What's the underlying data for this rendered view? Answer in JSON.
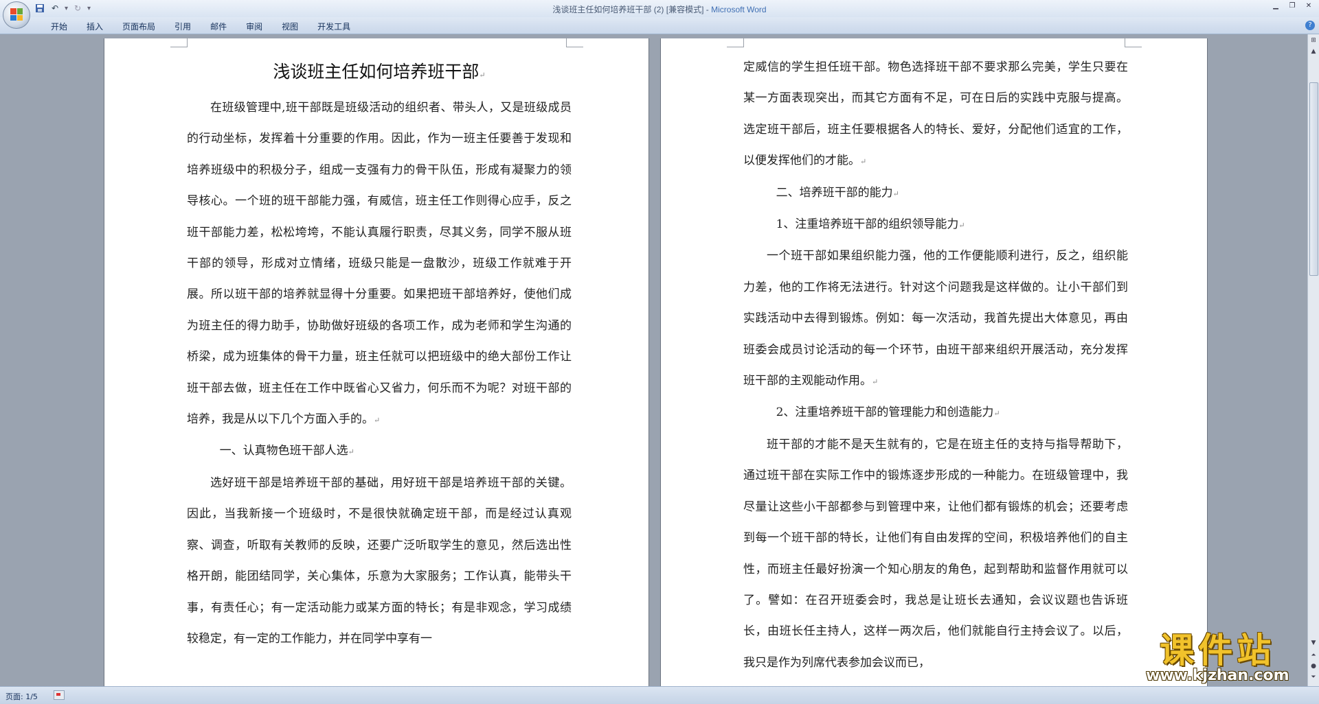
{
  "window": {
    "title": "浅谈班主任如何培养班干部 (2) [兼容模式]",
    "separator": " - ",
    "app_name": "Microsoft Word"
  },
  "ribbon": {
    "tabs": [
      "开始",
      "插入",
      "页面布局",
      "引用",
      "邮件",
      "审阅",
      "视图",
      "开发工具"
    ]
  },
  "status": {
    "page": "页面: 1/5"
  },
  "document": {
    "title": "浅谈班主任如何培养班干部",
    "left_paragraphs": [
      "在班级管理中,班干部既是班级活动的组织者、带头人，又是班级成员的行动坐标，发挥着十分重要的作用。因此，作为一班主任要善于发现和培养班级中的积极分子，组成一支强有力的骨干队伍，形成有凝聚力的领导核心。一个班的班干部能力强，有威信，班主任工作则得心应手，反之班干部能力差，松松垮垮，不能认真履行职责，尽其义务，同学不服从班干部的领导，形成对立情绪，班级只能是一盘散沙，班级工作就难于开展。所以班干部的培养就显得十分重要。如果把班干部培养好，使他们成为班主任的得力助手，协助做好班级的各项工作，成为老师和学生沟通的桥梁，成为班集体的骨干力量，班主任就可以把班级中的绝大部份工作让班干部去做，班主任在工作中既省心又省力，何乐而不为呢？对班干部的培养，我是从以下几个方面入手的。"
    ],
    "left_heading_1": "一、认真物色班干部人选",
    "left_paragraph_2": "选好班干部是培养班干部的基础，用好班干部是培养班干部的关键。因此，当我新接一个班级时，不是很快就确定班干部，而是经过认真观察、调查，听取有关教师的反映，还要广泛听取学生的意见，然后选出性格开朗，能团结同学，关心集体，乐意为大家服务；工作认真，能带头干事，有责任心；有一定活动能力或某方面的特长；有是非观念，学习成绩较稳定，有一定的工作能力，并在同学中享有一",
    "right_paragraph_1": "定威信的学生担任班干部。物色选择班干部不要求那么完美，学生只要在某一方面表现突出，而其它方面有不足，可在日后的实践中克服与提高。选定班干部后，班主任要根据各人的特长、爱好，分配他们适宜的工作，以便发挥他们的才能。",
    "right_heading_2": "二、培养班干部的能力",
    "right_subheading_1": "1、注重培养班干部的组织领导能力",
    "right_paragraph_2": "一个班干部如果组织能力强，他的工作便能顺利进行，反之，组织能力差，他的工作将无法进行。针对这个问题我是这样做的。让小干部们到实践活动中去得到锻炼。例如：每一次活动，我首先提出大体意见，再由班委会成员讨论活动的每一个环节，由班干部来组织开展活动，充分发挥班干部的主观能动作用。",
    "right_subheading_2": "2、注重培养班干部的管理能力和创造能力",
    "right_paragraph_3": "班干部的才能不是天生就有的，它是在班主任的支持与指导帮助下，通过班干部在实际工作中的锻炼逐步形成的一种能力。在班级管理中，我尽量让这些小干部都参与到管理中来，让他们都有锻炼的机会；还要考虑到每一个班干部的特长，让他们有自由发挥的空间，积极培养他们的自主性，而班主任最好扮演一个知心朋友的角色，起到帮助和监督作用就可以了。譬如：在召开班委会时，我总是让班长去通知，会议议题也告诉班长，由班长任主持人，这样一两次后，他们就能自行主持会议了。以后，我只是作为列席代表参加会议而已，"
  },
  "paragraph_mark": "↵",
  "watermark": {
    "text": "课件站",
    "url": "www.kjzhan.com"
  },
  "icons": {
    "office_button": "office-logo-icon",
    "save": "save-icon",
    "undo": "undo-icon",
    "redo": "redo-icon",
    "help": "help-icon"
  },
  "colors": {
    "app_name": "#3f6fb3",
    "watermark": "#f1c22b"
  }
}
